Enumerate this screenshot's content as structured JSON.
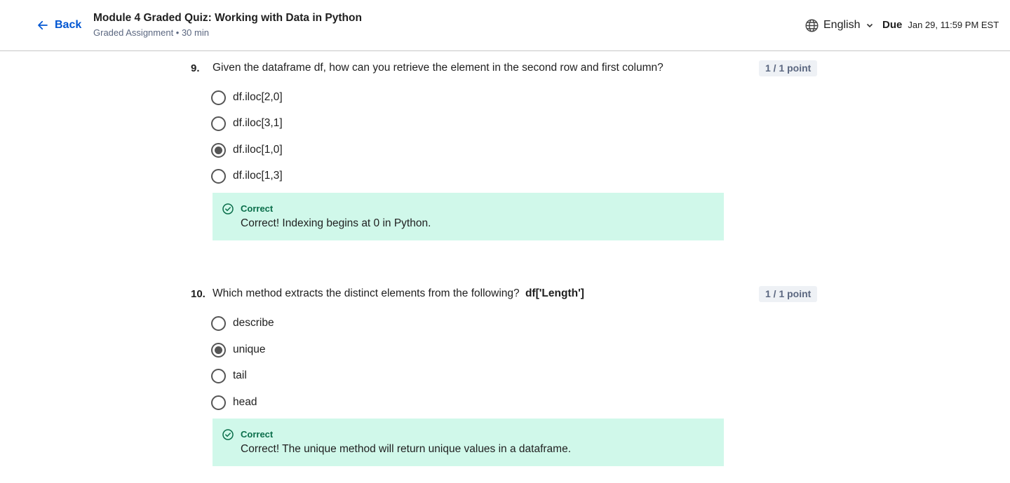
{
  "header": {
    "back_label": "Back",
    "title": "Module 4 Graded Quiz: Working with Data in Python",
    "subtitle": "Graded Assignment • 30 min",
    "language": "English",
    "due_label": "Due",
    "due_date": "Jan 29, 11:59 PM EST"
  },
  "questions": [
    {
      "number": "9.",
      "text": "Given the dataframe df, how can you retrieve the element in the second row and first column?",
      "points": "1 / 1 point",
      "options": [
        {
          "label": "df.iloc[2,0]",
          "selected": false
        },
        {
          "label": "df.iloc[3,1]",
          "selected": false
        },
        {
          "label": "df.iloc[1,0]",
          "selected": true
        },
        {
          "label": "df.iloc[1,3]",
          "selected": false
        }
      ],
      "feedback": {
        "status": "Correct",
        "message": "Correct! Indexing begins at 0 in Python."
      }
    },
    {
      "number": "10.",
      "text": "Which method extracts the distinct elements from the following?",
      "code": "df['Length']",
      "points": "1 / 1 point",
      "options": [
        {
          "label": "describe",
          "selected": false
        },
        {
          "label": "unique",
          "selected": true
        },
        {
          "label": "tail",
          "selected": false
        },
        {
          "label": "head",
          "selected": false
        }
      ],
      "feedback": {
        "status": "Correct",
        "message": "Correct! The unique method will return unique values in a dataframe."
      }
    }
  ],
  "colors": {
    "accent": "#0056d2",
    "feedback_bg": "#d0f8ea",
    "feedback_label": "#0a6e4a",
    "points_bg": "#eef1f5"
  }
}
